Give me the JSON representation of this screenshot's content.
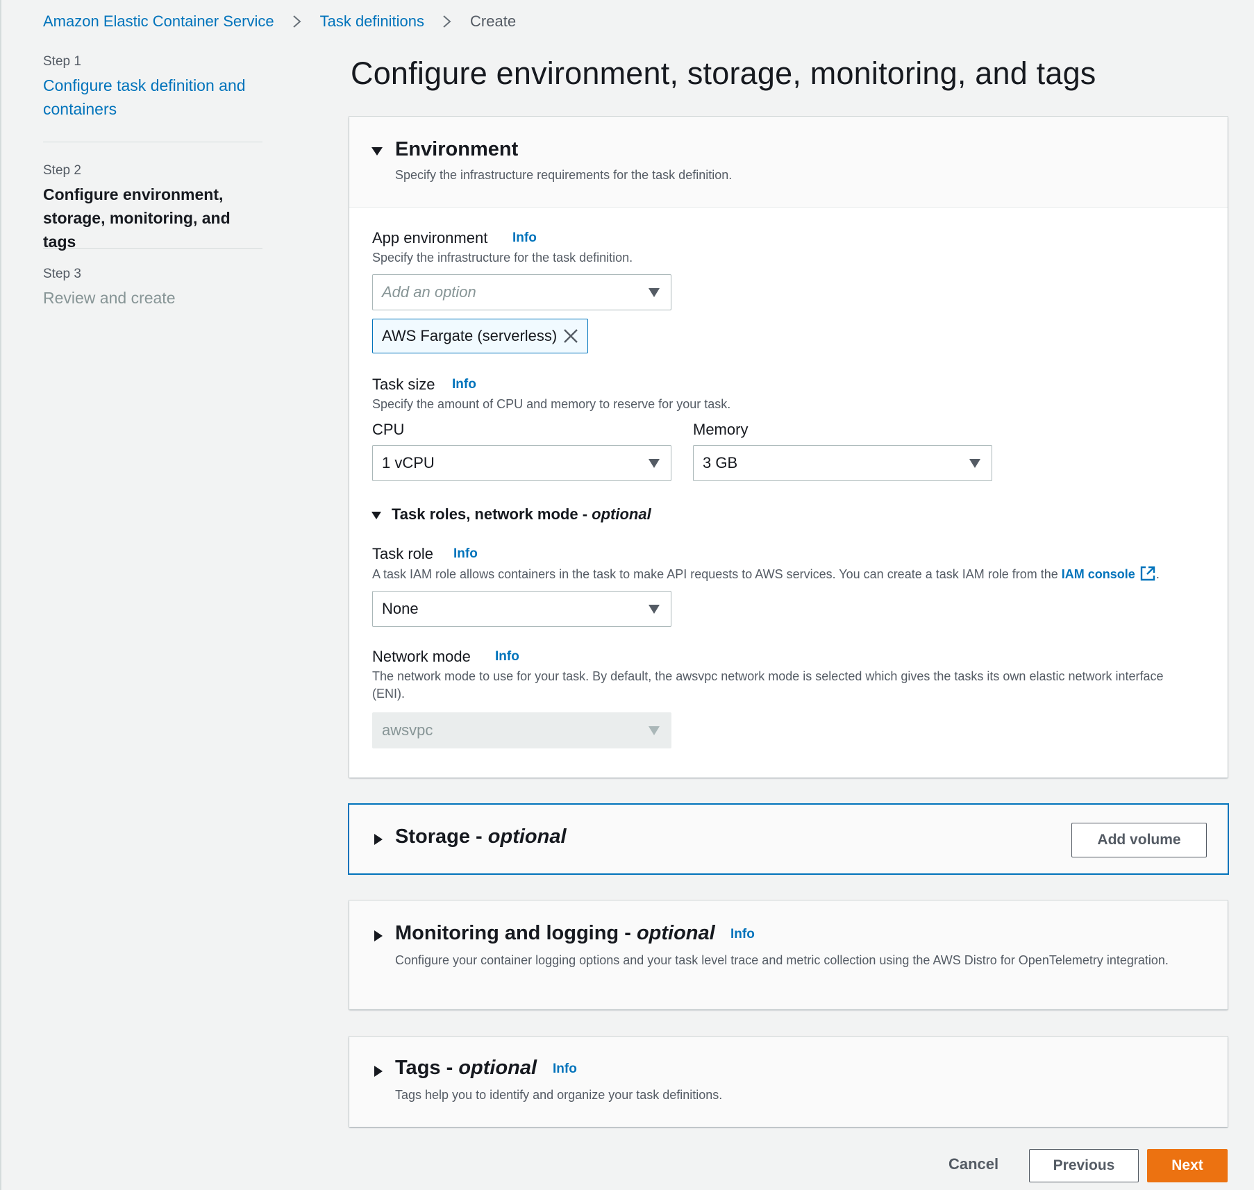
{
  "breadcrumb": {
    "items": [
      "Amazon Elastic Container Service",
      "Task definitions",
      "Create"
    ]
  },
  "steps": [
    {
      "num": "Step 1",
      "title": "Configure task definition and containers",
      "state": "link"
    },
    {
      "num": "Step 2",
      "title": "Configure environment, storage, monitoring, and tags",
      "state": "current"
    },
    {
      "num": "Step 3",
      "title": "Review and create",
      "state": "disabled"
    }
  ],
  "page_title": "Configure environment, storage, monitoring, and tags",
  "environment": {
    "heading": "Environment",
    "description": "Specify the infrastructure requirements for the task definition.",
    "app_env": {
      "label": "App environment",
      "info": "Info",
      "description": "Specify the infrastructure for the task definition.",
      "placeholder": "Add an option",
      "token": "AWS Fargate (serverless)"
    },
    "task_size": {
      "label": "Task size",
      "info": "Info",
      "description": "Specify the amount of CPU and memory to reserve for your task.",
      "cpu_label": "CPU",
      "cpu_value": "1 vCPU",
      "memory_label": "Memory",
      "memory_value": "3 GB"
    },
    "roles_section": {
      "title": "Task roles, network mode",
      "dash": " - ",
      "optional": "optional"
    },
    "task_role": {
      "label": "Task role",
      "info": "Info",
      "description": "A task IAM role allows containers in the task to make API requests to AWS services. You can create a task IAM role from the ",
      "link": "IAM console",
      "period": ".",
      "value": "None"
    },
    "network_mode": {
      "label": "Network mode",
      "info": "Info",
      "description": "The network mode to use for your task. By default, the awsvpc network mode is selected which gives the tasks its own elastic network interface (ENI).",
      "value": "awsvpc"
    }
  },
  "storage": {
    "heading": "Storage",
    "dash": " - ",
    "optional": "optional",
    "button": "Add volume"
  },
  "monitoring": {
    "heading": "Monitoring and logging",
    "dash": " - ",
    "optional": "optional",
    "info": "Info",
    "description": "Configure your container logging options and your task level trace and metric collection using the AWS Distro for OpenTelemetry integration."
  },
  "tags": {
    "heading": "Tags",
    "dash": " - ",
    "optional": "optional",
    "info": "Info",
    "description": "Tags help you to identify and organize your task definitions."
  },
  "footer": {
    "cancel": "Cancel",
    "previous": "Previous",
    "next": "Next"
  },
  "colors": {
    "link": "#0073bb",
    "primary_button": "#ec7211",
    "page_bg": "#f2f3f3"
  }
}
